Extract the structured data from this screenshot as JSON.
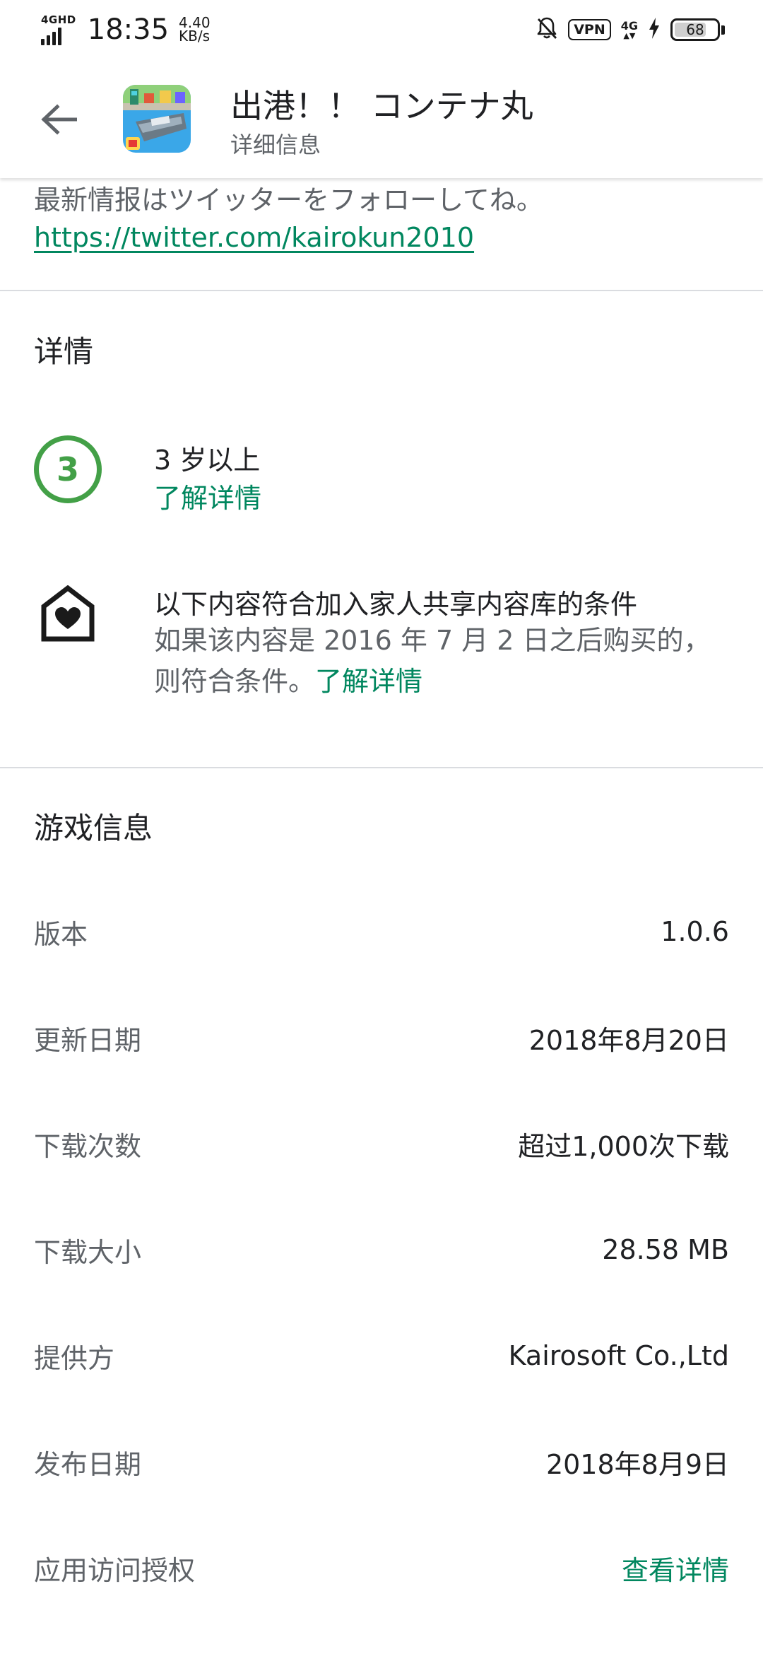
{
  "status_bar": {
    "network": "4GHD",
    "time": "18:35",
    "speed_value": "4.40",
    "speed_unit": "KB/s",
    "vpn": "VPN",
    "net_right": "4G",
    "battery": "68"
  },
  "app_bar": {
    "title": "出港！！ コンテナ丸",
    "subtitle": "详细信息"
  },
  "description": {
    "text": "最新情报はツイッターをフォローしてね。",
    "link": "https://twitter.com/kairokun2010"
  },
  "details": {
    "heading": "详情",
    "rating": {
      "badge": "3",
      "label": "3 岁以上",
      "link": "了解详情"
    },
    "family": {
      "title": "以下内容符合加入家人共享内容库的条件",
      "body": "如果该内容是 2016 年 7 月 2 日之后购买的，则符合条件。",
      "link": "了解详情"
    }
  },
  "game_info": {
    "heading": "游戏信息",
    "rows": [
      {
        "label": "版本",
        "value": "1.0.6"
      },
      {
        "label": "更新日期",
        "value": "2018年8月20日"
      },
      {
        "label": "下载次数",
        "value": "超过1,000次下载"
      },
      {
        "label": "下载大小",
        "value": "28.58 MB"
      },
      {
        "label": "提供方",
        "value": "Kairosoft Co.,Ltd"
      },
      {
        "label": "发布日期",
        "value": "2018年8月9日"
      },
      {
        "label": "应用访问授权",
        "value": "查看详情"
      }
    ]
  },
  "colors": {
    "accent": "#01875f",
    "rating_green": "#43a047"
  },
  "icons": [
    "signal-icon",
    "mute-icon",
    "charging-icon",
    "back-arrow-icon",
    "rating-3-icon",
    "family-library-icon"
  ]
}
